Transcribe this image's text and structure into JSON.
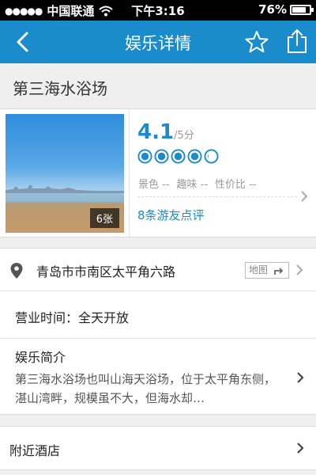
{
  "status_bar": {
    "carrier": "中国联通",
    "time": "下午3:16",
    "battery": "76%"
  },
  "nav": {
    "title": "娱乐详情"
  },
  "place": {
    "name": "第三海水浴场",
    "photo_count": "6张",
    "score": "4.1",
    "score_suffix": "/5分",
    "rating_circles": 4.1,
    "subscores": [
      "景色 --",
      "趣味 --",
      "性价比 --"
    ],
    "reviews_link": "8条游友点评"
  },
  "details": {
    "address": "青岛市市南区太平角六路",
    "map_button": "地图",
    "hours": "营业时间：全天开放",
    "intro_title": "娱乐简介",
    "intro_text": "第三海水浴场也叫山海天浴场，位于太平角东侧，湛山湾畔，规模虽不大，但海水却…"
  },
  "nearby": {
    "hotels_label": "附近酒店"
  },
  "colors": {
    "accent": "#1a8ccc",
    "nav_bg": "#1a8ccc",
    "status_bg": "#000000"
  },
  "icons": [
    "signal-dots-icon",
    "wifi-icon",
    "battery-icon",
    "back-icon",
    "star-icon",
    "share-icon",
    "rating-circle-icon",
    "chevron-right-icon",
    "location-pin-icon",
    "map-arrow-icon"
  ]
}
